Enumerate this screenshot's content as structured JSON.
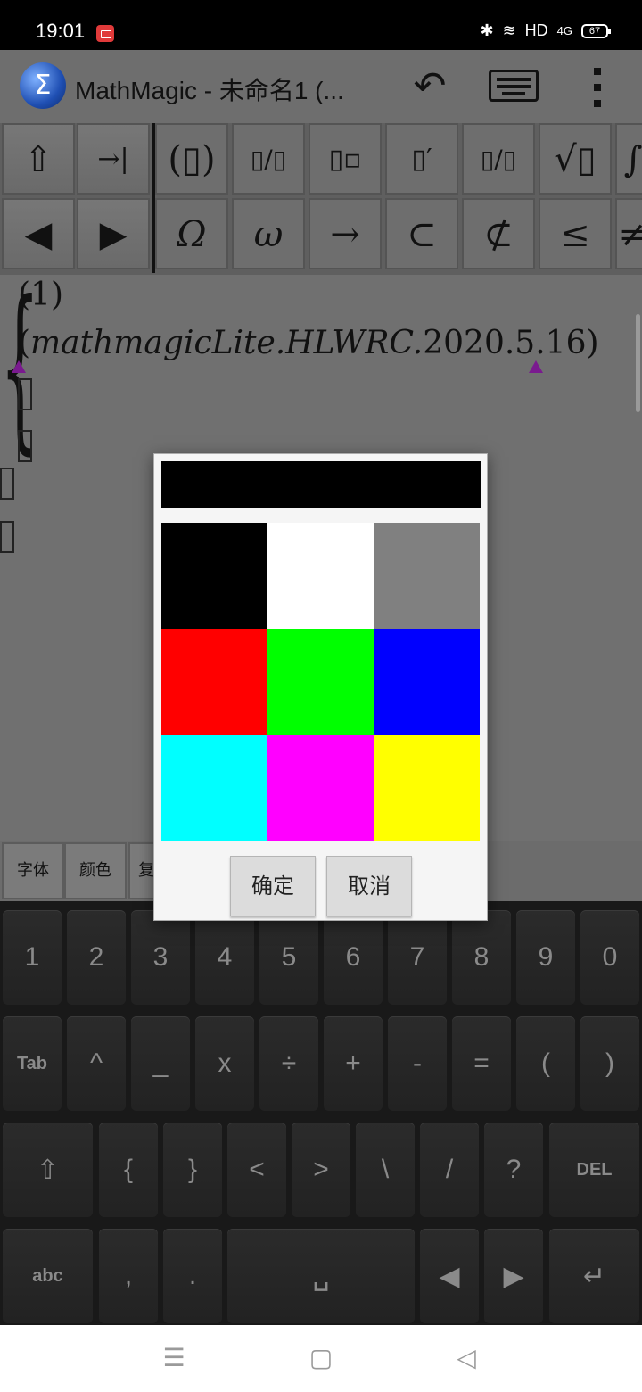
{
  "status_bar": {
    "time": "19:01",
    "network": "HD",
    "signal": "4G",
    "battery": "67"
  },
  "app_bar": {
    "title": "MathMagic  - 未命名1 (...",
    "logo_symbol": "Σ",
    "undo_icon": "undo-icon",
    "keyboard_icon": "keyboard-icon",
    "menu_icon": "overflow-menu-icon"
  },
  "symbols": {
    "row1": [
      "⇧",
      "→|",
      "(▯)",
      "▯/▯",
      "▯▫",
      "▯′",
      "▯/▯",
      "√▯",
      "∫"
    ],
    "row2": [
      "◀",
      "▶",
      "Ω",
      "ω",
      "→",
      "⊂",
      "⊄",
      "≤",
      "≠"
    ]
  },
  "editor": {
    "line1": "(1)",
    "line2_open": "(",
    "line2_italic": "mathmagicLite.HLWRC.",
    "line2_num": "2020.5.16",
    "line2_close": ")"
  },
  "tabs": [
    "字体",
    "颜色",
    "复"
  ],
  "color_dialog": {
    "preview_color": "#000000",
    "swatches": [
      "#000000",
      "#ffffff",
      "#808080",
      "#ff0000",
      "#00ff00",
      "#0000ff",
      "#00ffff",
      "#ff00ff",
      "#ffff00"
    ],
    "ok_label": "确定",
    "cancel_label": "取消"
  },
  "keyboard": {
    "row1": [
      "1",
      "2",
      "3",
      "4",
      "5",
      "6",
      "7",
      "8",
      "9",
      "0"
    ],
    "row2": [
      "Tab",
      "^",
      "_",
      "x",
      "÷",
      "+",
      "-",
      "=",
      "(",
      ")"
    ],
    "row3": [
      "⇧",
      "{",
      "}",
      "<",
      ">",
      "\\",
      "/",
      "?",
      "DEL"
    ],
    "row4": [
      "abc",
      ",",
      ".",
      "␣",
      "◀",
      "▶",
      "↵"
    ]
  },
  "nav_bar": {
    "recents_icon": "☰",
    "home_icon": "▢",
    "back_icon": "◁"
  }
}
